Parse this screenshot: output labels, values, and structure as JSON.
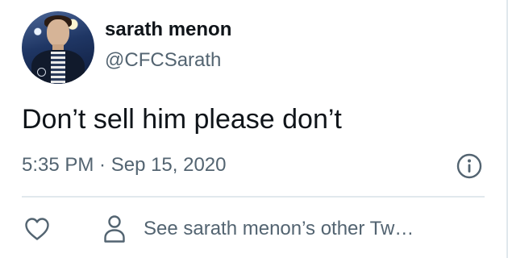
{
  "tweet": {
    "author": {
      "display_name": "sarath menon",
      "handle": "@CFCSarath",
      "avatar_alt": "sarath menon profile photo"
    },
    "text": "Don’t sell him please don’t",
    "timestamp": "5:35 PM · Sep 15, 2020"
  },
  "actions": {
    "like_icon": "heart-icon",
    "info_icon": "info-icon",
    "profile_icon": "person-icon",
    "profile_link_label": "See sarath menon’s other Tw…"
  },
  "colors": {
    "primary_text": "#0f1419",
    "secondary_text": "#536471",
    "divider": "#e1e8ed",
    "background": "#ffffff"
  }
}
